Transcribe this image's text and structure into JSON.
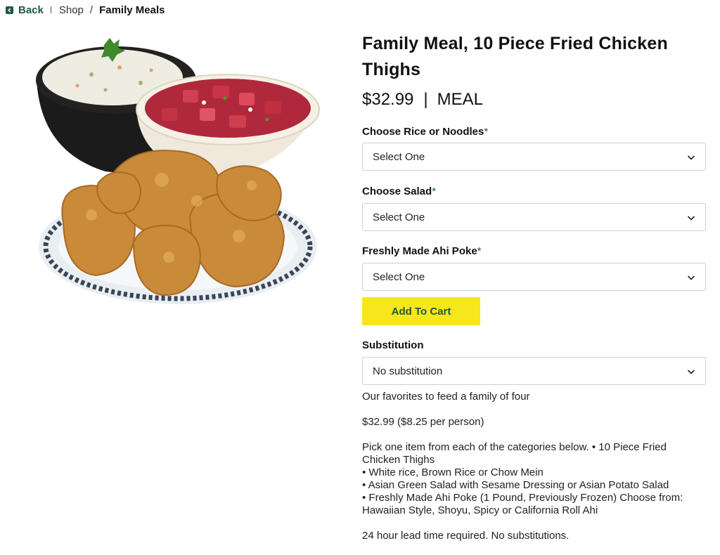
{
  "breadcrumb": {
    "back": "Back",
    "shop": "Shop",
    "separator": "/",
    "current": "Family Meals"
  },
  "product": {
    "title": "Family Meal, 10 Piece Fried Chicken Thighs",
    "price": "$32.99",
    "price_separator": "|",
    "unit": "MEAL"
  },
  "options": [
    {
      "label": "Choose Rice or Noodles",
      "required_mark": "*",
      "value": "Select One"
    },
    {
      "label": "Choose Salad",
      "required_mark": "*",
      "value": "Select One"
    },
    {
      "label": "Freshly Made Ahi Poke",
      "required_mark": "*",
      "value": "Select One"
    }
  ],
  "add_to_cart": "Add To Cart",
  "substitution": {
    "label": "Substitution",
    "value": "No substitution"
  },
  "description": {
    "intro": "Our favorites to feed a family of four",
    "price_line": "$32.99 ($8.25 per person)",
    "pick_line": "Pick one item from each of the categories below. • 10 Piece Fried Chicken Thighs",
    "bullet_rice": "• White rice, Brown Rice or Chow Mein",
    "bullet_salad": "• Asian Green Salad with Sesame Dressing or Asian Potato Salad",
    "bullet_poke": "• Freshly Made Ahi Poke (1 Pound, Previously Frozen) Choose from: Hawaiian Style, Shoyu, Spicy or California Roll Ahi",
    "lead_time": "24 hour lead time required. No substitutions."
  },
  "colors": {
    "brand_green": "#1f5a3e",
    "cart_yellow": "#f6e61b",
    "border": "#cfcfcf"
  },
  "icons": {
    "back": "chevron-left-icon",
    "dropdown": "chevron-down-icon"
  }
}
